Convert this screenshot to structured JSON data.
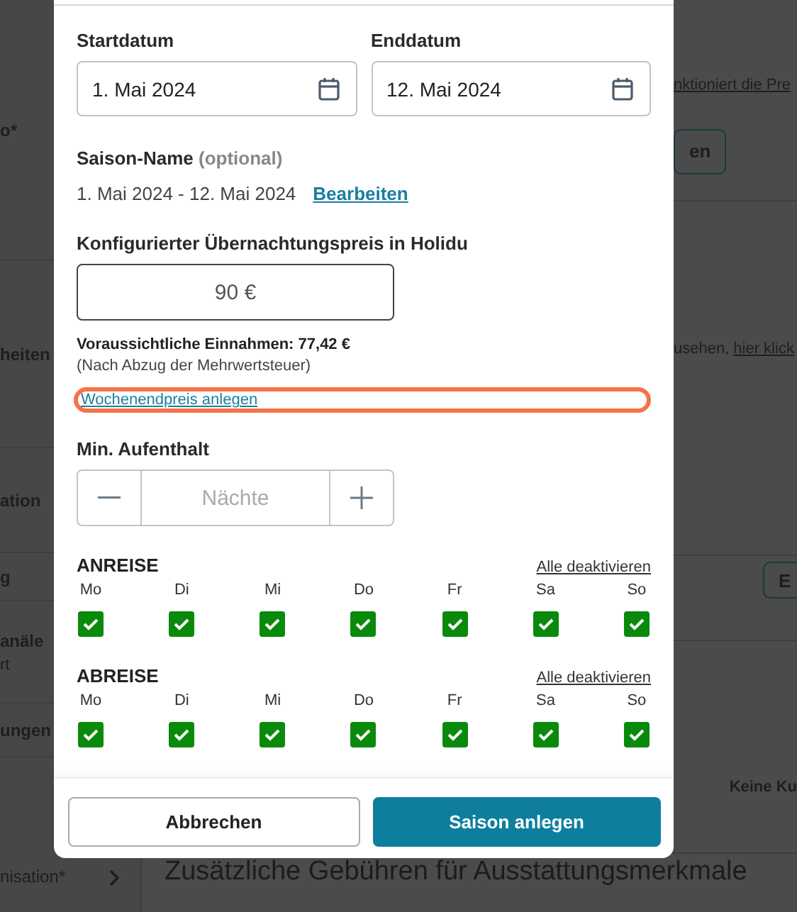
{
  "background": {
    "sidebar_items": [
      {
        "label": "o*",
        "expandable": false
      },
      {
        "label": "heiten",
        "expandable": false
      },
      {
        "label": "ation",
        "expandable": false
      },
      {
        "label": "g",
        "expandable": false
      },
      {
        "label": "anäle",
        "sublabel": "rt",
        "expandable": false
      },
      {
        "label": "ungen",
        "expandable": false
      },
      {
        "label": "nisation*",
        "expandable": true
      }
    ],
    "info_link": "nktioniert die Pre",
    "button": "en",
    "hint": "usehen,",
    "hint_link": "hier klick",
    "button_2": "E",
    "status": "Keine Ku",
    "section_title": "Zusätzliche Gebühren für Ausstattungsmerkmale"
  },
  "modal": {
    "start_date": {
      "label": "Startdatum",
      "value": "1. Mai 2024"
    },
    "end_date": {
      "label": "Enddatum",
      "value": "12. Mai 2024"
    },
    "season_name": {
      "label": "Saison-Name",
      "optional": "(optional)",
      "value": "1. Mai 2024 - 12. Mai 2024",
      "edit_link": "Bearbeiten"
    },
    "price": {
      "label": "Konfigurierter Übernachtungspreis in Holidu",
      "value": "90 €"
    },
    "estimate": "Voraussichtliche Einnahmen: 77,42 €",
    "estimate_note": "(Nach Abzug der Mehrwertsteuer)",
    "weekend_link": {
      "label": "Wochenendpreis anlegen",
      "highlighted": true
    },
    "min_stay": {
      "label": "Min. Aufenthalt",
      "placeholder": "Nächte"
    },
    "arrival": {
      "title": "ANREISE",
      "action": "Alle deaktivieren",
      "days": [
        {
          "label": "Mo",
          "checked": true
        },
        {
          "label": "Di",
          "checked": true
        },
        {
          "label": "Mi",
          "checked": true
        },
        {
          "label": "Do",
          "checked": true
        },
        {
          "label": "Fr",
          "checked": true
        },
        {
          "label": "Sa",
          "checked": true
        },
        {
          "label": "So",
          "checked": true
        }
      ]
    },
    "departure": {
      "title": "ABREISE",
      "action": "Alle deaktivieren",
      "days": [
        {
          "label": "Mo",
          "checked": true
        },
        {
          "label": "Di",
          "checked": true
        },
        {
          "label": "Mi",
          "checked": true
        },
        {
          "label": "Do",
          "checked": true
        },
        {
          "label": "Fr",
          "checked": true
        },
        {
          "label": "Sa",
          "checked": true
        },
        {
          "label": "So",
          "checked": true
        }
      ]
    },
    "buttons": {
      "cancel": "Abbrechen",
      "submit": "Saison anlegen"
    }
  }
}
